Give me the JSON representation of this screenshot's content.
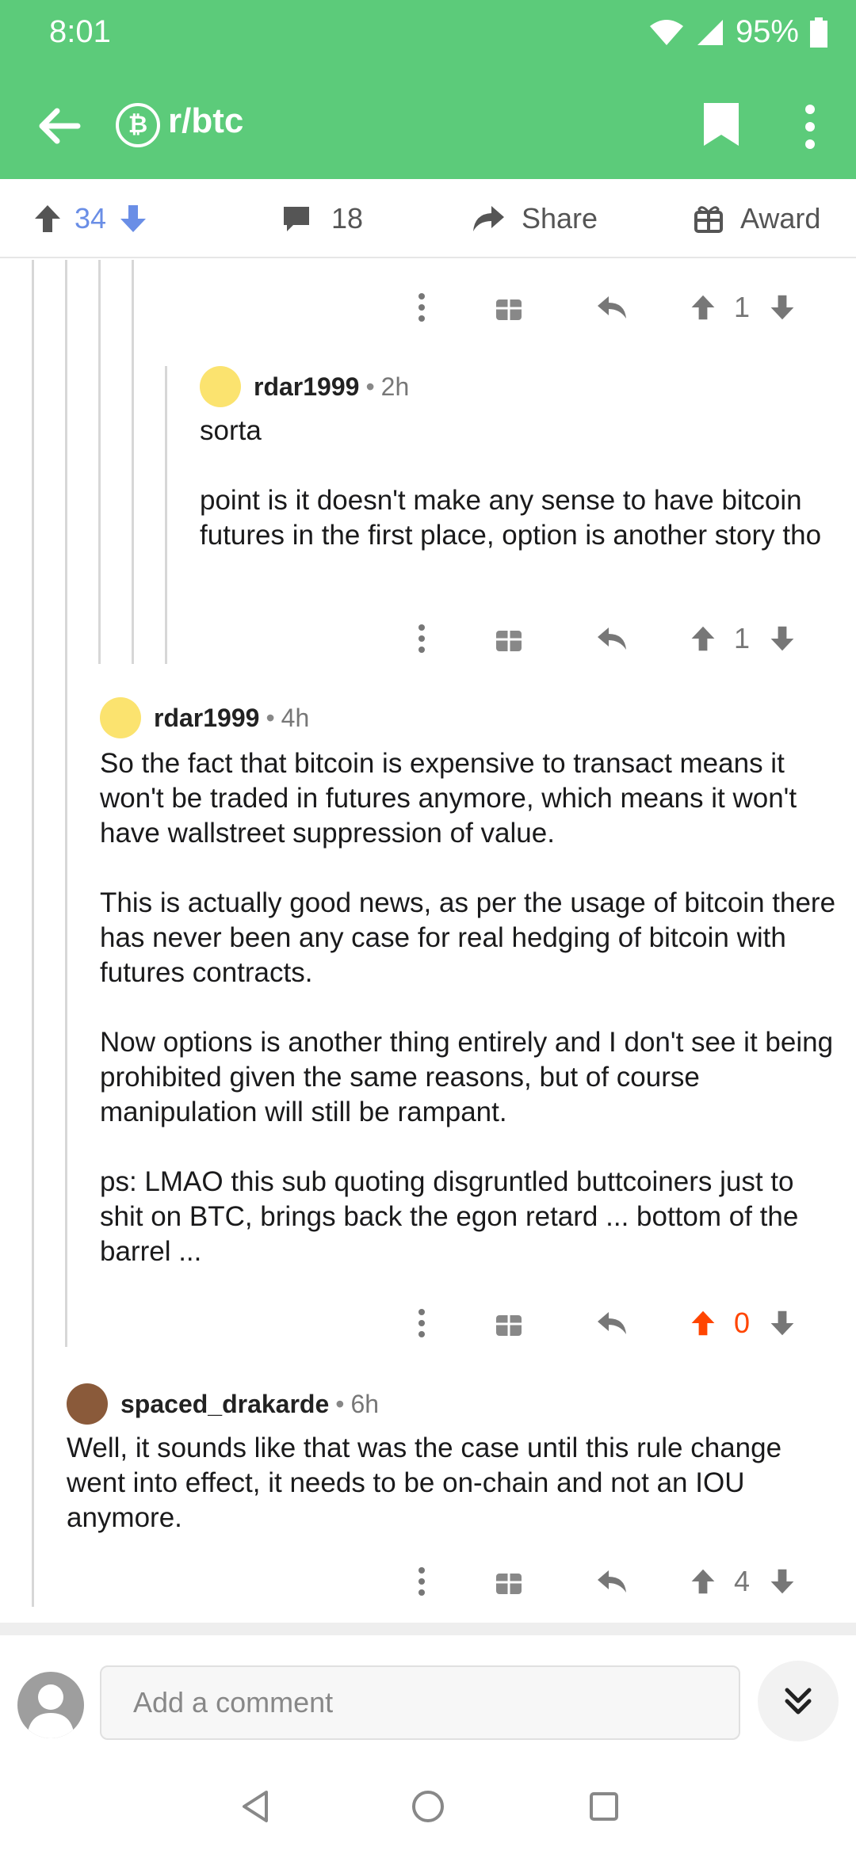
{
  "status": {
    "time": "8:01",
    "battery": "95%"
  },
  "appbar": {
    "subreddit": "r/btc",
    "sub_icon_glyph": "₿"
  },
  "post_actions": {
    "score": "34",
    "comments": "18",
    "share": "Share",
    "award": "Award"
  },
  "comments": [
    {
      "score": "1"
    },
    {
      "username": "rdar1999",
      "age": "2h",
      "paragraphs": [
        "sorta",
        "point is it doesn't make any sense to have bitcoin futures in the first place, option is another story tho"
      ],
      "score": "1"
    },
    {
      "username": "rdar1999",
      "age": "4h",
      "paragraphs": [
        "So the fact that bitcoin is expensive to transact means it won't be traded in futures anymore, which means it won't have wallstreet suppression of value.",
        "This is actually good news, as per the usage of bitcoin there has never been any case for real hedging of bitcoin with futures contracts.",
        "Now options is another thing entirely and I don't see it being prohibited given the same reasons, but of course manipulation will still be rampant.",
        "ps: LMAO this sub quoting disgruntled buttcoiners just to shit on BTC, brings back the egon retard ... bottom of the barrel ..."
      ],
      "score": "0"
    },
    {
      "username": "spaced_drakarde",
      "age": "6h",
      "paragraphs": [
        "Well, it sounds like that was the case until this rule change went into effect, it needs to be on-chain and not an IOU anymore."
      ],
      "score": "4"
    }
  ],
  "composer": {
    "placeholder": "Add a comment"
  },
  "colors": {
    "brand": "#5ccb7a",
    "upvote_active": "#ff4500",
    "vote_blue": "#6a8ee6"
  }
}
